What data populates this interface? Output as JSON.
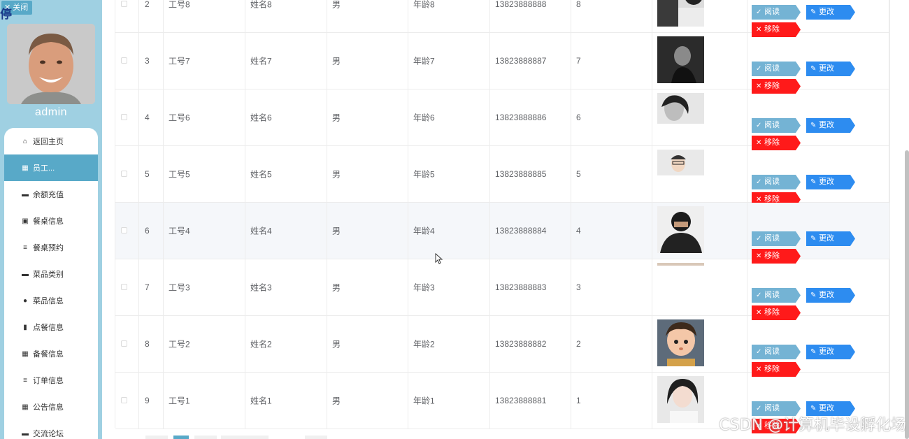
{
  "sidebar": {
    "close_label": "关闭",
    "pause_char": "停",
    "username": "admin",
    "menu": [
      {
        "label": "返回主页",
        "icon": "home-icon",
        "glyph": "⌂"
      },
      {
        "label": "员工...",
        "icon": "grid-icon",
        "glyph": "▦"
      },
      {
        "label": "余额充值",
        "icon": "card-icon",
        "glyph": "▬"
      },
      {
        "label": "餐桌信息",
        "icon": "clipboard-icon",
        "glyph": "▣"
      },
      {
        "label": "餐桌预约",
        "icon": "list-icon",
        "glyph": "≡"
      },
      {
        "label": "菜品类别",
        "icon": "chat-icon",
        "glyph": "▬"
      },
      {
        "label": "菜品信息",
        "icon": "location-icon",
        "glyph": "●"
      },
      {
        "label": "点餐信息",
        "icon": "thumb-icon",
        "glyph": "▮"
      },
      {
        "label": "备餐信息",
        "icon": "apps-icon",
        "glyph": "▦"
      },
      {
        "label": "订单信息",
        "icon": "list-icon",
        "glyph": "≡"
      },
      {
        "label": "公告信息",
        "icon": "apps-icon",
        "glyph": "▦"
      },
      {
        "label": "交流论坛",
        "icon": "chat-icon",
        "glyph": "▬"
      }
    ],
    "active_index": 1
  },
  "table": {
    "rows": [
      {
        "index": "2",
        "emp_no": "工号8",
        "name": "姓名8",
        "gender": "男",
        "age": "年龄8",
        "phone": "13823888888",
        "num": "8"
      },
      {
        "index": "3",
        "emp_no": "工号7",
        "name": "姓名7",
        "gender": "男",
        "age": "年龄7",
        "phone": "13823888887",
        "num": "7"
      },
      {
        "index": "4",
        "emp_no": "工号6",
        "name": "姓名6",
        "gender": "男",
        "age": "年龄6",
        "phone": "13823888886",
        "num": "6"
      },
      {
        "index": "5",
        "emp_no": "工号5",
        "name": "姓名5",
        "gender": "男",
        "age": "年龄5",
        "phone": "13823888885",
        "num": "5"
      },
      {
        "index": "6",
        "emp_no": "工号4",
        "name": "姓名4",
        "gender": "男",
        "age": "年龄4",
        "phone": "13823888884",
        "num": "4"
      },
      {
        "index": "7",
        "emp_no": "工号3",
        "name": "姓名3",
        "gender": "男",
        "age": "年龄3",
        "phone": "13823888883",
        "num": "3"
      },
      {
        "index": "8",
        "emp_no": "工号2",
        "name": "姓名2",
        "gender": "男",
        "age": "年龄2",
        "phone": "13823888882",
        "num": "2"
      },
      {
        "index": "9",
        "emp_no": "工号1",
        "name": "姓名1",
        "gender": "男",
        "age": "年龄1",
        "phone": "13823888881",
        "num": "1"
      }
    ],
    "actions": {
      "read": "阅读",
      "edit": "更改",
      "delete": "移除"
    }
  },
  "watermark": "CSDN @计算机毕设孵化场",
  "colors": {
    "sidebar": "#9fd0e2",
    "active": "#58a9c8",
    "read": "#74b3d4",
    "edit": "#2d8cf0",
    "delete": "#ff1a1a"
  }
}
